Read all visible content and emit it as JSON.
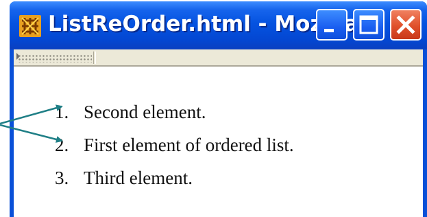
{
  "window": {
    "title": "ListReOrder.html - Mozilla"
  },
  "controls": {
    "minimize": "minimize",
    "maximize": "maximize",
    "close": "close"
  },
  "list": {
    "items": [
      {
        "number": "1.",
        "text": "Second element."
      },
      {
        "number": "2.",
        "text": "First element of ordered list."
      },
      {
        "number": "3.",
        "text": "Third element."
      }
    ]
  },
  "colors": {
    "titlebar": "#0553e0",
    "arrow": "#1f7f86",
    "close_button": "#e0502a"
  }
}
